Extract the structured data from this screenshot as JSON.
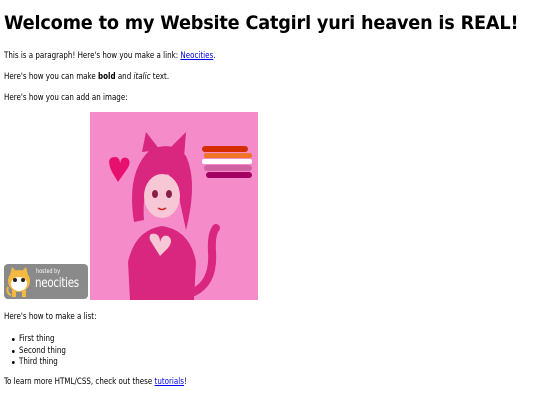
{
  "heading": "Welcome to my Website Catgirl yuri heaven is REAL!",
  "paragraph1": {
    "before": "This is a paragraph! Here's how you make a link: ",
    "link": "Neocities",
    "after": "."
  },
  "paragraph2": {
    "before": "Here's how you can make ",
    "bold": "bold",
    "middle": " and ",
    "italic": "italic",
    "after": " text."
  },
  "paragraph3": "Here's how you can add an image:",
  "badge": {
    "small_text": "hosted by",
    "big_text": "neocities"
  },
  "paragraph4": "Here's how to make a list:",
  "list_items": [
    "First thing",
    "Second thing",
    "Third thing"
  ],
  "paragraph5": {
    "before": "To learn more HTML/CSS, check out these ",
    "link": "tutorials",
    "after": "!"
  },
  "colors": {
    "link": "#0000ee",
    "art_background": "#f58cc9",
    "badge_background": "#8a8a8a"
  }
}
